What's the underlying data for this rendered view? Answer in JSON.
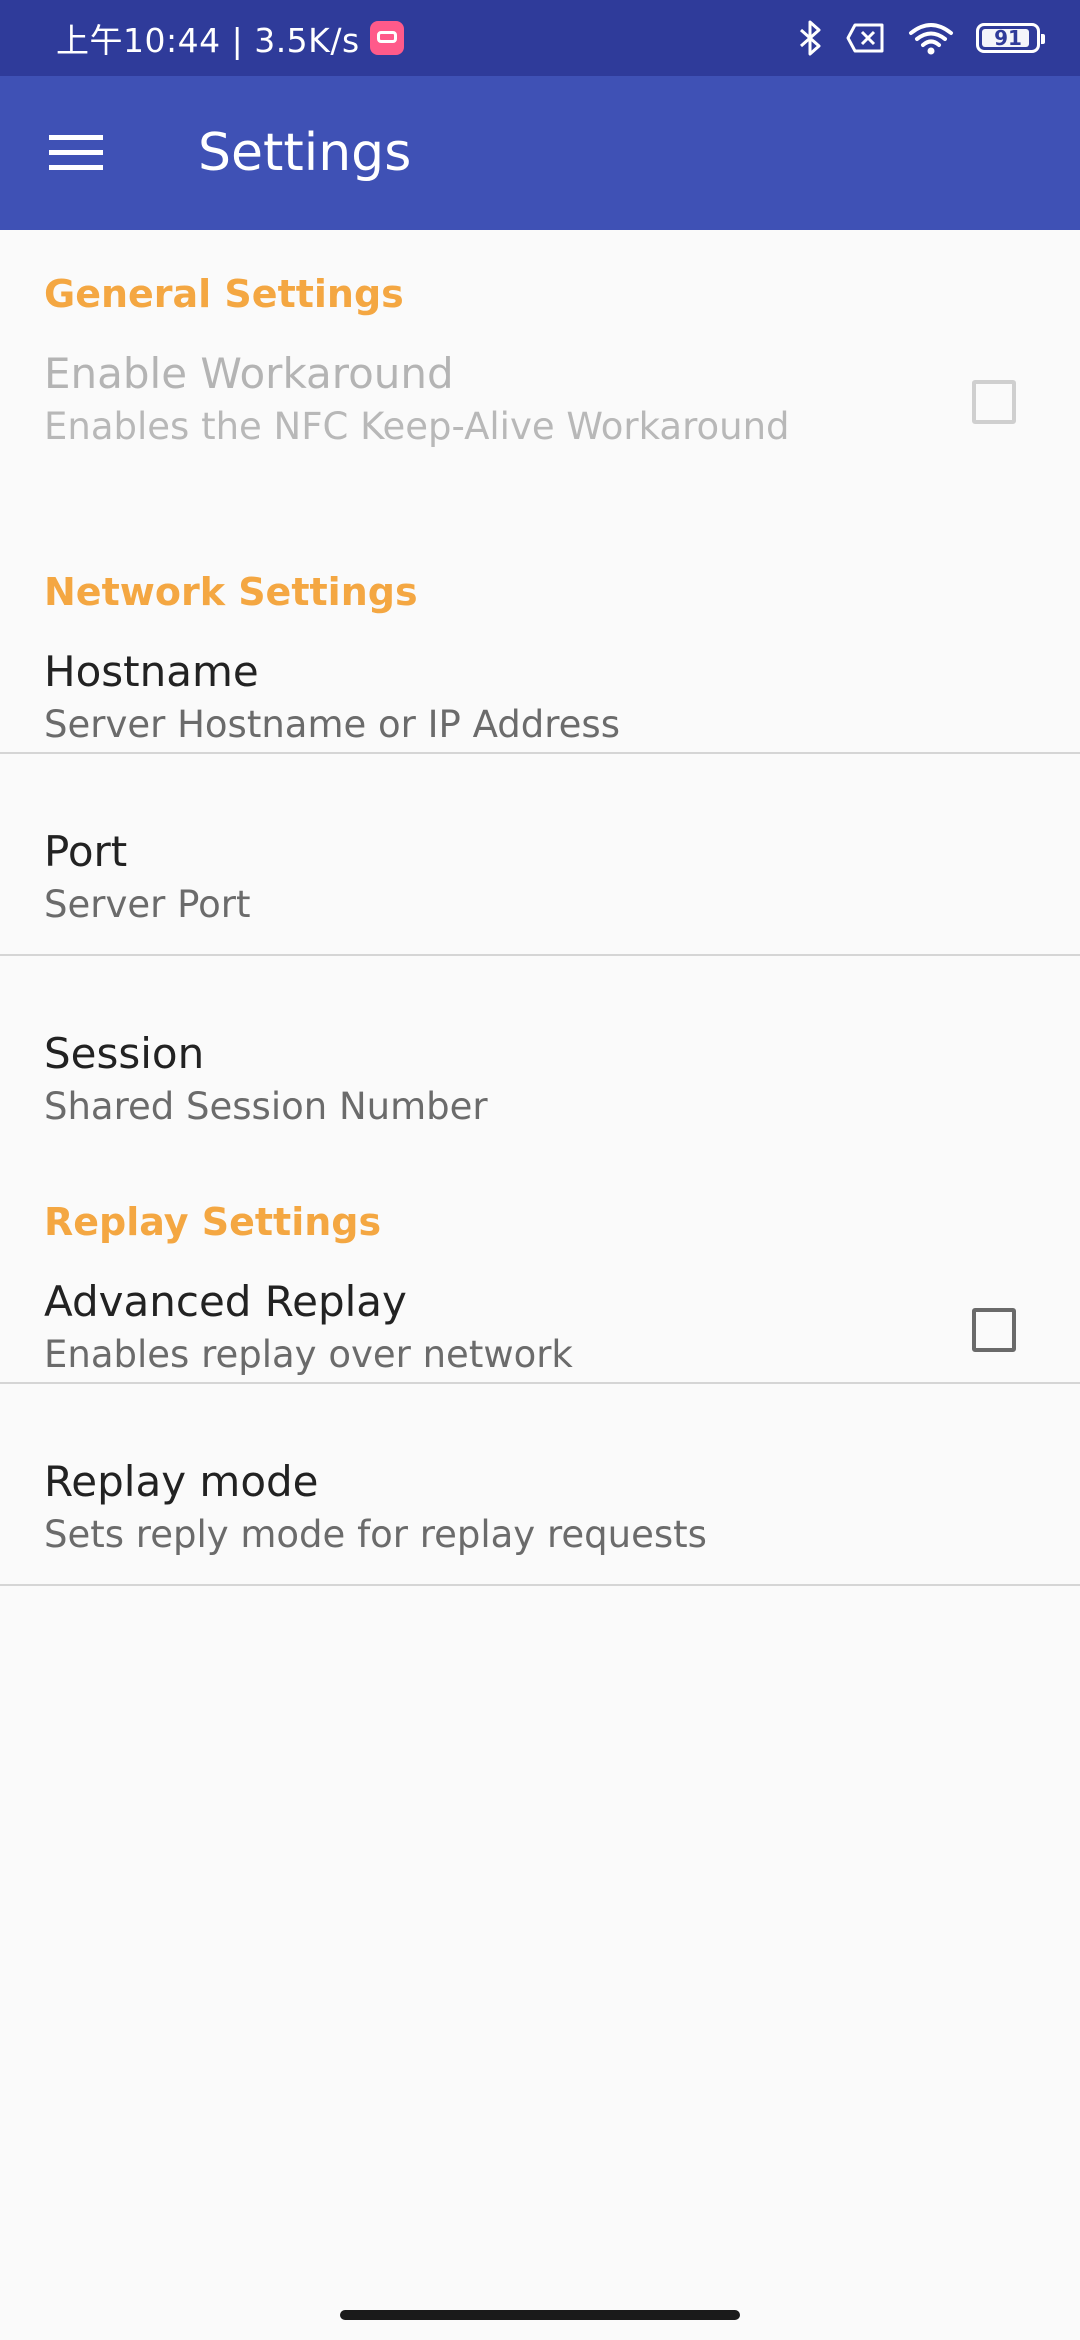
{
  "status_bar": {
    "time_speed": "上午10:44 | 3.5K/s",
    "battery_level": "91",
    "battery_fraction": 0.91,
    "icons": [
      "app-notification-icon",
      "bluetooth-icon",
      "no-sim-icon",
      "wifi-icon",
      "battery-icon"
    ],
    "background_color": "#2f3b9a"
  },
  "app_bar": {
    "title": "Settings",
    "menu_icon": "hamburger-menu-icon",
    "background_color": "#3f51b5"
  },
  "theme": {
    "category_color": "#f4a742",
    "page_background": "#fafafa"
  },
  "sections": [
    {
      "header": "General Settings",
      "items": [
        {
          "title": "Enable Workaround",
          "summary": "Enables the NFC Keep-Alive Workaround",
          "widget": "checkbox",
          "checked": false,
          "enabled": false
        }
      ]
    },
    {
      "header": "Network Settings",
      "items": [
        {
          "title": "Hostname",
          "summary": "Server Hostname or IP Address"
        },
        {
          "title": "Port",
          "summary": "Server Port"
        },
        {
          "title": "Session",
          "summary": "Shared Session Number"
        }
      ]
    },
    {
      "header": "Replay Settings",
      "items": [
        {
          "title": "Advanced Replay",
          "summary": "Enables replay over network",
          "widget": "checkbox",
          "checked": false,
          "enabled": true
        },
        {
          "title": "Replay mode",
          "summary": "Sets reply mode for replay requests"
        }
      ]
    }
  ]
}
